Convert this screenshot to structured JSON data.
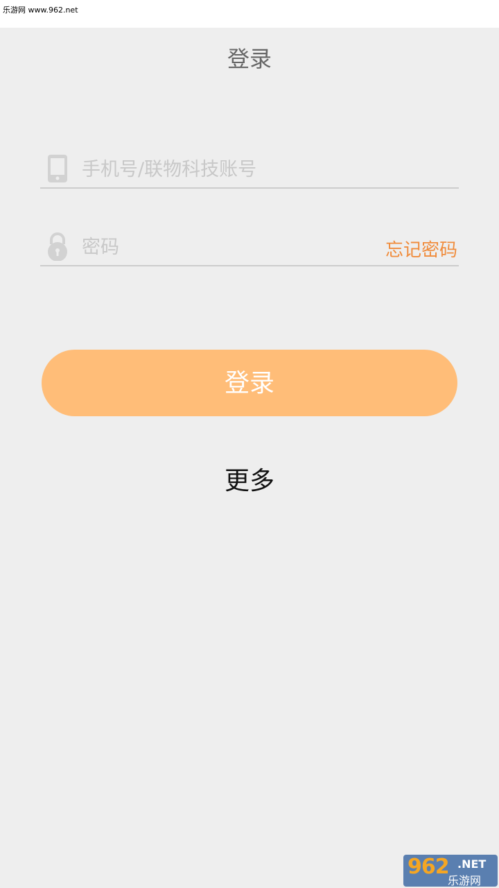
{
  "watermark_top": "乐游网 www.962.net",
  "page_title": "登录",
  "phone_field": {
    "placeholder": "手机号/联物科技账号",
    "icon": "phone-icon"
  },
  "password_field": {
    "placeholder": "密码",
    "icon": "lock-icon",
    "forgot_label": "忘记密码"
  },
  "login_button_label": "登录",
  "more_label": "更多",
  "logo": {
    "number": "962",
    "suffix": ".NET",
    "cn": "乐游网"
  },
  "colors": {
    "background": "#eeeeee",
    "accent": "#ffbd78",
    "forgot": "#f08c3c",
    "placeholder": "#c8c8c8"
  }
}
